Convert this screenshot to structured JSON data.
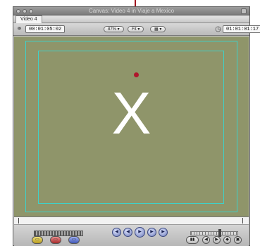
{
  "window": {
    "title": "Canvas: Video 4 in Viaje a Mexico",
    "tab_label": "Video 4"
  },
  "toolbar": {
    "timecode_current": "00:01:05:02",
    "zoom_label": "87%",
    "view_label": "Fit",
    "overlay_label": "",
    "timecode_duration": "01:01:01:17"
  },
  "canvas": {
    "main_text": "X",
    "background_color": "#8f956a",
    "guide_color": "#3fd1c8",
    "marker_color": "#b0162c"
  },
  "transport": {
    "buttons": [
      "previous-edit",
      "play-in-to-out",
      "play",
      "play-around",
      "next-edit"
    ],
    "lower_left_buttons": [
      "insert",
      "overwrite",
      "replace"
    ],
    "lower_right_buttons": [
      "match-frame",
      "mark-in",
      "mark-out",
      "add-marker",
      "mark-clip"
    ]
  },
  "icons": {
    "playhead_sync": "playhead-sync-icon",
    "clock": "clock-icon"
  }
}
